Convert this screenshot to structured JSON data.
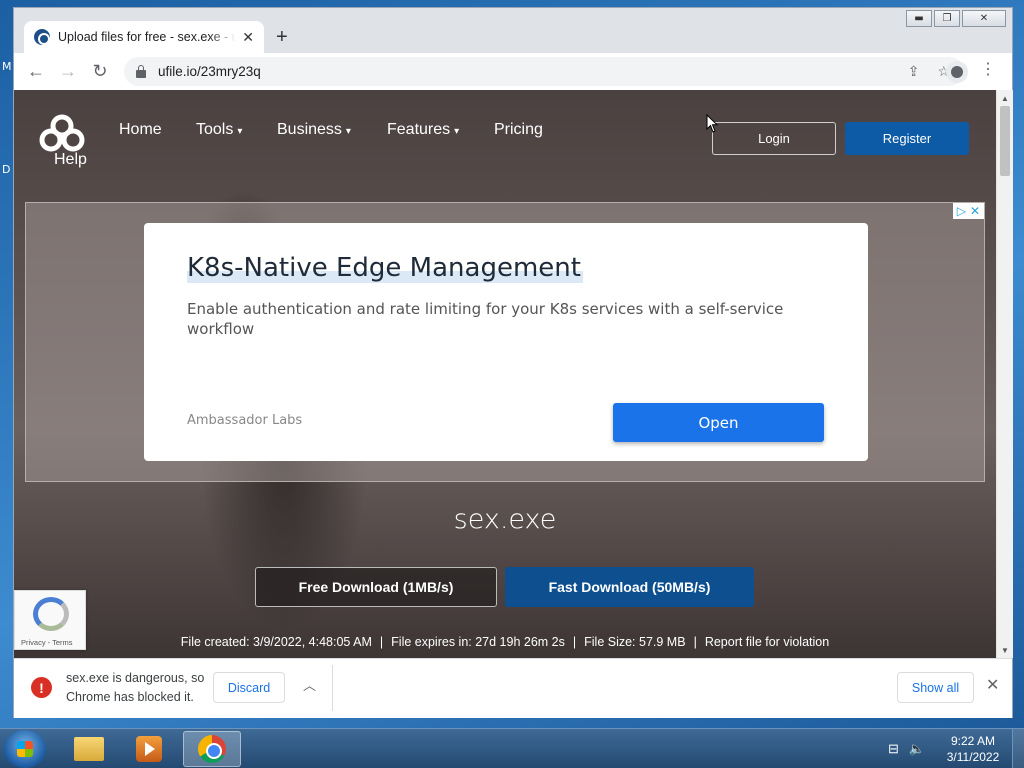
{
  "desktop": {
    "letter_m": "M",
    "letter_d": "D"
  },
  "browser": {
    "window_controls": {
      "minimize": "▬",
      "maximize": "❐",
      "close": "✕"
    },
    "tab": {
      "title": "Upload files for free - sex.exe - ufile.io",
      "close": "✕"
    },
    "new_tab": "+",
    "url": "ufile.io/23mry23q"
  },
  "site": {
    "logo_label": "Help",
    "nav": {
      "home": "Home",
      "tools": "Tools",
      "business": "Business",
      "features": "Features",
      "pricing": "Pricing"
    },
    "login": "Login",
    "register": "Register"
  },
  "ad": {
    "title": "K8s-Native Edge Management",
    "description": "Enable authentication and rate limiting for your K8s services with a self-service workflow",
    "brand": "Ambassador Labs",
    "cta": "Open"
  },
  "file": {
    "name": "sex.exe",
    "free_download": "Free Download (1MB/s)",
    "fast_download": "Fast Download (50MB/s)",
    "created": "File created: 3/9/2022, 4:48:05 AM",
    "expires": "File expires in: 27d 19h 26m 2s",
    "size": "File Size: 57.9 MB",
    "report": "Report file for violation",
    "separator": "|"
  },
  "recaptcha": {
    "links": "Privacy - Terms"
  },
  "download_shelf": {
    "message": "sex.exe is dangerous, so Chrome has blocked it.",
    "discard": "Discard",
    "show_all": "Show all",
    "close": "✕"
  },
  "taskbar": {
    "time": "9:22 AM",
    "date": "3/11/2022"
  },
  "colors": {
    "register_bg": "#0d5aa7",
    "fast_download_bg": "#0d4f8f",
    "ad_cta_bg": "#1a73e8",
    "danger": "#d93025"
  }
}
